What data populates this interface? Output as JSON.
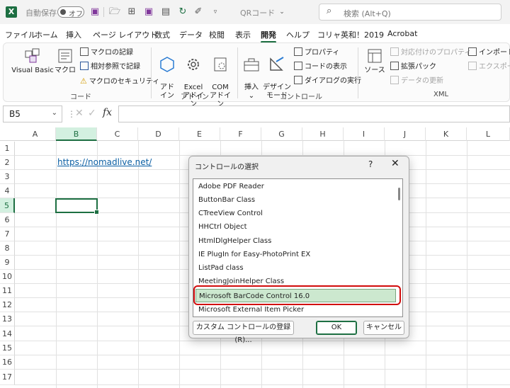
{
  "titlebar": {
    "autosave_label": "自動保存",
    "autosave_state": "オフ",
    "filename": "QRコード",
    "search_placeholder": "検索 (Alt+Q)"
  },
  "menu": {
    "tabs": [
      "ファイル",
      "ホーム",
      "挿入",
      "ページ レイアウト",
      "数式",
      "データ",
      "校閲",
      "表示",
      "開発",
      "ヘルプ",
      "コリャ英和！2019",
      "Acrobat"
    ],
    "active": "開発"
  },
  "ribbon": {
    "code": {
      "label": "コード",
      "visual_basic": "Visual Basic",
      "macro": "マクロ",
      "record_macro": "マクロの記録",
      "relative_ref": "相対参照で記録",
      "macro_security": "マクロのセキュリティ"
    },
    "addins": {
      "label": "アドイン",
      "addin": "アド\nイン",
      "excel_addin": "Excel\nアドイン",
      "com_addin": "COM\nアドイン"
    },
    "controls": {
      "label": "コントロール",
      "insert": "挿入",
      "insert_arrow": "⌄",
      "design_mode": "デザイン\nモード",
      "properties": "プロパティ",
      "view_code": "コードの表示",
      "run_dialog": "ダイアログの実行"
    },
    "xml": {
      "label": "XML",
      "source": "ソース",
      "map_properties": "対応付けのプロパティ",
      "expansion_packs": "拡張パック",
      "refresh_data": "データの更新",
      "import": "インポート",
      "export": "エクスポート"
    }
  },
  "formula_bar": {
    "cell_ref": "B5",
    "fx": "fx",
    "value": ""
  },
  "sheet": {
    "columns": [
      "A",
      "B",
      "C",
      "D",
      "E",
      "F",
      "G",
      "H",
      "I",
      "J",
      "K",
      "L"
    ],
    "rows": [
      "1",
      "2",
      "3",
      "4",
      "5",
      "6",
      "7",
      "8",
      "9",
      "10",
      "11",
      "12",
      "13",
      "14",
      "15",
      "16",
      "17"
    ],
    "selected_column": "B",
    "selected_row": "5",
    "cell_b2": "https://nomadlive.net/"
  },
  "dialog": {
    "title": "コントロールの選択",
    "help": "?",
    "close": "✕",
    "items": [
      "Adobe PDF Reader",
      "ButtonBar Class",
      "CTreeView Control",
      "HHCtrl Object",
      "HtmlDlgHelper Class",
      "IE PlugIn for Easy-PhotoPrint EX",
      "ListPad class",
      "MeetingJoinHelper Class",
      "Microsoft BarCode Control 16.0",
      "Microsoft External Item Picker"
    ],
    "selected_index": 8,
    "register_button": "カスタム コントロールの登録(R)...",
    "ok_button": "OK",
    "cancel_button": "キャンセル"
  },
  "colors": {
    "excel_green": "#1d6f42",
    "highlight_red": "#d10c0c",
    "selection_fill": "#cce8cf"
  }
}
